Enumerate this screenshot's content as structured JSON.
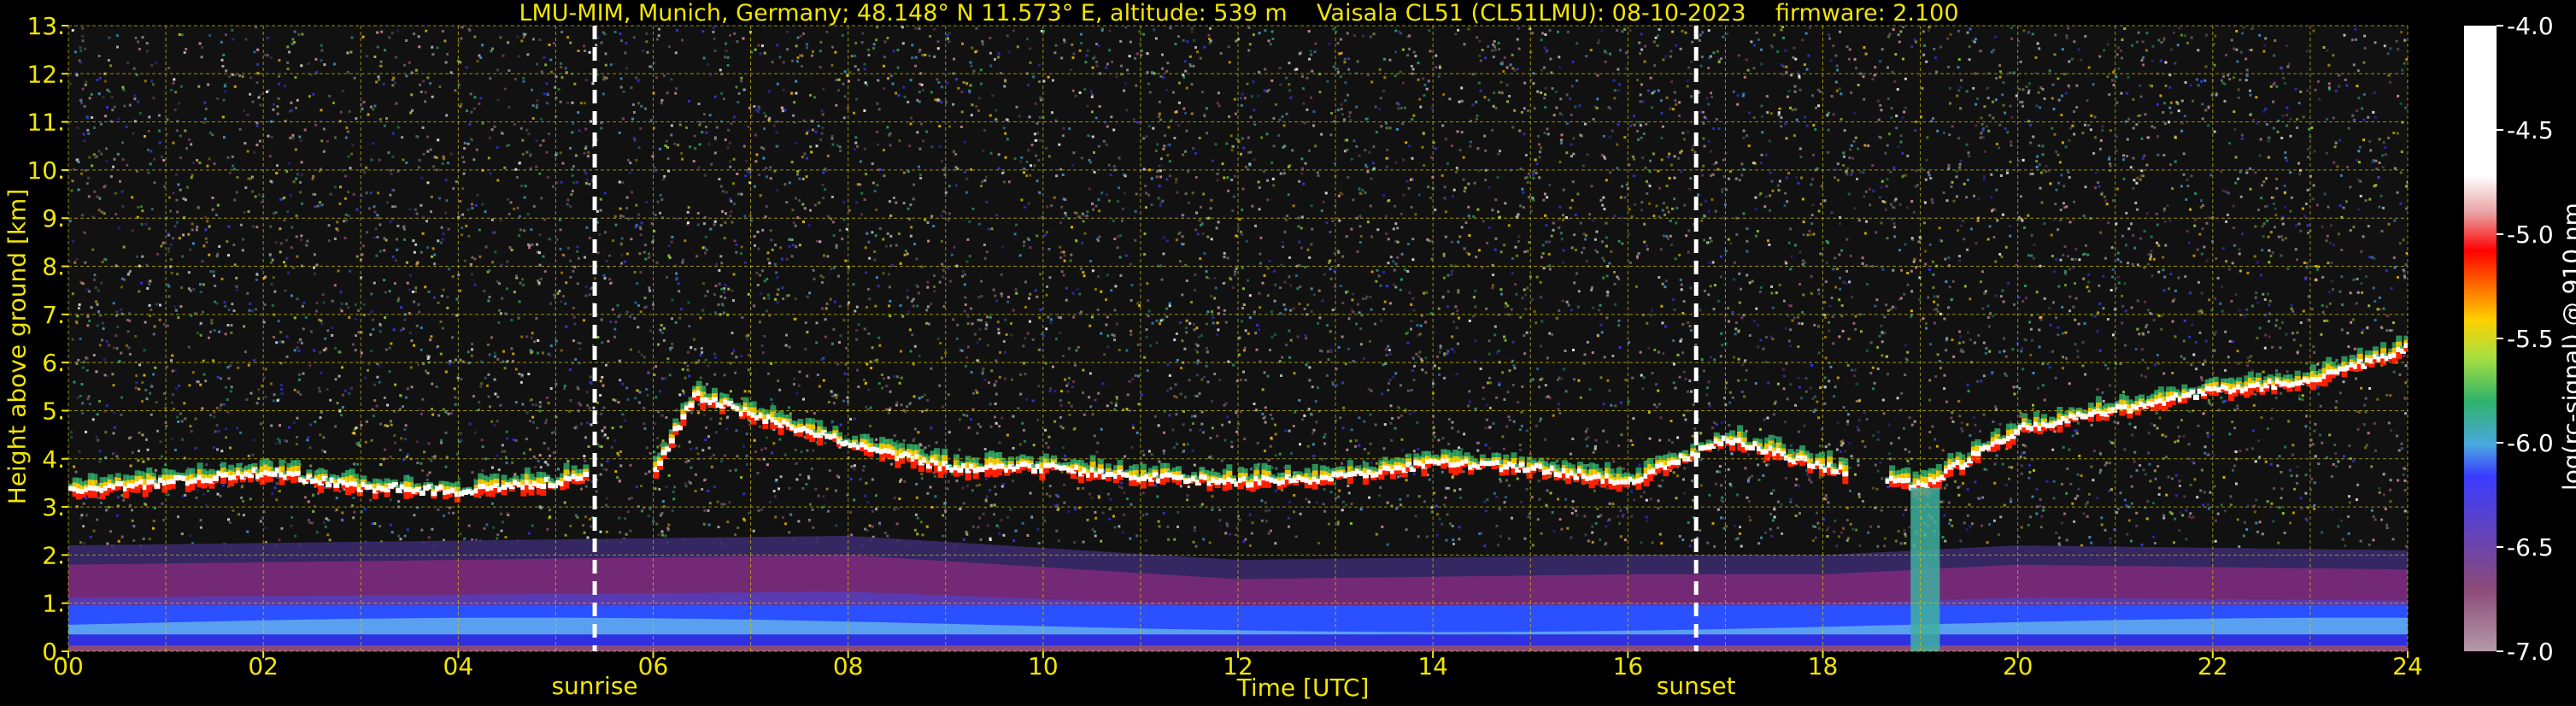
{
  "title": "LMU-MIM, Munich, Germany; 48.148° N 11.573° E, altitude: 539 m    Vaisala CL51 (CL51LMU): 08-10-2023    firmware: 2.100",
  "colors": {
    "axis_text": "#f2e600",
    "background": "#000000",
    "grid": "#d8c800",
    "colorbar_text": "#ffffff"
  },
  "chart_data": {
    "type": "heatmap",
    "title": "LMU-MIM, Munich, Germany; 48.148° N 11.573° E, altitude: 539 m    Vaisala CL51 (CL51LMU): 08-10-2023    firmware: 2.100",
    "xlabel": "Time [UTC]",
    "ylabel": "Height above ground [km]",
    "xlim": [
      0,
      24
    ],
    "ylim": [
      0,
      13
    ],
    "x_ticks": [
      "00",
      "02",
      "04",
      "06",
      "08",
      "10",
      "12",
      "14",
      "16",
      "18",
      "20",
      "22",
      "24"
    ],
    "y_ticks": [
      "0.",
      "1.",
      "2.",
      "3.",
      "4.",
      "5.",
      "6.",
      "7.",
      "8.",
      "9.",
      "10.",
      "11.",
      "12.",
      "13."
    ],
    "grid": true,
    "colorbar": {
      "label": "log(rc-signal) @ 910 nm",
      "range": [
        -7.0,
        -4.0
      ],
      "ticks": [
        "-4.0",
        "-4.5",
        "-5.0",
        "-5.5",
        "-6.0",
        "-6.5",
        "-7.0"
      ]
    },
    "annotations": [
      {
        "label": "sunrise",
        "time": 5.4
      },
      {
        "label": "sunset",
        "time": 16.7
      }
    ],
    "cloud_layer_km": [
      [
        0.0,
        3.3
      ],
      [
        1.0,
        3.5
      ],
      [
        2.0,
        3.7
      ],
      [
        3.0,
        3.4
      ],
      [
        4.0,
        3.3
      ],
      [
        5.0,
        3.5
      ],
      [
        6.0,
        3.8
      ],
      [
        6.4,
        5.3
      ],
      [
        7.0,
        4.9
      ],
      [
        8.0,
        4.3
      ],
      [
        9.0,
        3.8
      ],
      [
        10.0,
        3.8
      ],
      [
        11.0,
        3.6
      ],
      [
        12.0,
        3.5
      ],
      [
        13.0,
        3.6
      ],
      [
        14.0,
        3.9
      ],
      [
        15.0,
        3.8
      ],
      [
        16.0,
        3.5
      ],
      [
        17.0,
        4.4
      ],
      [
        18.0,
        3.8
      ],
      [
        19.0,
        3.4
      ],
      [
        20.0,
        4.6
      ],
      [
        21.0,
        5.0
      ],
      [
        22.0,
        5.4
      ],
      [
        23.0,
        5.6
      ],
      [
        24.0,
        6.3
      ]
    ],
    "boundary_layer_km": [
      [
        0.0,
        1.8
      ],
      [
        4.0,
        1.9
      ],
      [
        8.0,
        2.0
      ],
      [
        12.0,
        1.5
      ],
      [
        16.0,
        1.6
      ],
      [
        18.0,
        1.6
      ],
      [
        20.0,
        1.8
      ],
      [
        24.0,
        1.7
      ]
    ]
  }
}
